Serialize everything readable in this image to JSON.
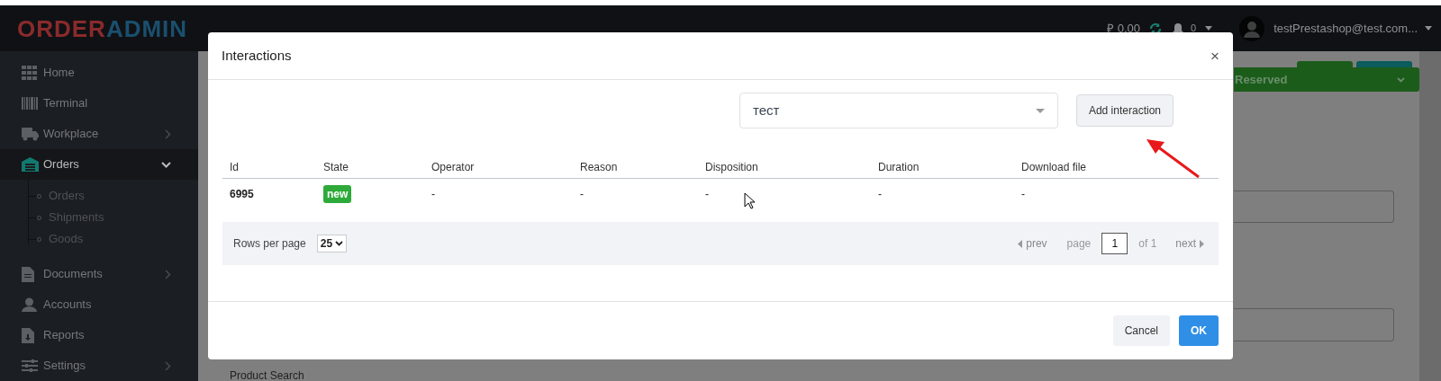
{
  "header": {
    "logo": [
      "ORDER",
      "ADMIN"
    ],
    "balance": "₽ 0.00",
    "notifications": "0",
    "user": "testPrestashop@test.com..."
  },
  "sidebar": {
    "items": [
      {
        "label": "Home",
        "selected": false
      },
      {
        "label": "Terminal",
        "selected": false
      },
      {
        "label": "Workplace",
        "expanded": false,
        "selected": false
      },
      {
        "label": "Orders",
        "expanded": true,
        "selected": true,
        "children": [
          {
            "label": "Orders"
          },
          {
            "label": "Shipments"
          },
          {
            "label": "Goods"
          }
        ]
      },
      {
        "label": "Documents",
        "expanded": false,
        "selected": false
      },
      {
        "label": "Accounts",
        "selected": false
      },
      {
        "label": "Reports",
        "selected": false
      },
      {
        "label": "Settings",
        "expanded": false,
        "selected": false
      }
    ]
  },
  "background": {
    "status_button": "Reserved",
    "field_label": "Product Search"
  },
  "modal": {
    "title": "Interactions",
    "close": "×",
    "select": {
      "value": "тест"
    },
    "add_button": "Add interaction",
    "table": {
      "columns": [
        "Id",
        "State",
        "Operator",
        "Reason",
        "Disposition",
        "Duration",
        "Download file"
      ],
      "rows": [
        {
          "cells": [
            {
              "kind": "id",
              "text": "6995"
            },
            {
              "kind": "badge",
              "text": "new",
              "color": "#2eaa3a"
            },
            {
              "kind": "text",
              "text": "-"
            },
            {
              "kind": "text",
              "text": "-"
            },
            {
              "kind": "text",
              "text": "-"
            },
            {
              "kind": "text",
              "text": "-"
            },
            {
              "kind": "text",
              "text": "-"
            }
          ]
        }
      ]
    },
    "pagination": {
      "rows_per_page_label": "Rows per page",
      "rows_per_page": "25",
      "prev": "prev",
      "page_label": "page",
      "page": "1",
      "of": "of 1",
      "next": "next"
    },
    "buttons": [
      {
        "label": "Cancel",
        "kind": "secondary"
      },
      {
        "label": "OK",
        "kind": "primary"
      }
    ]
  },
  "annotation_arrow": true,
  "mouse_cursor": true
}
